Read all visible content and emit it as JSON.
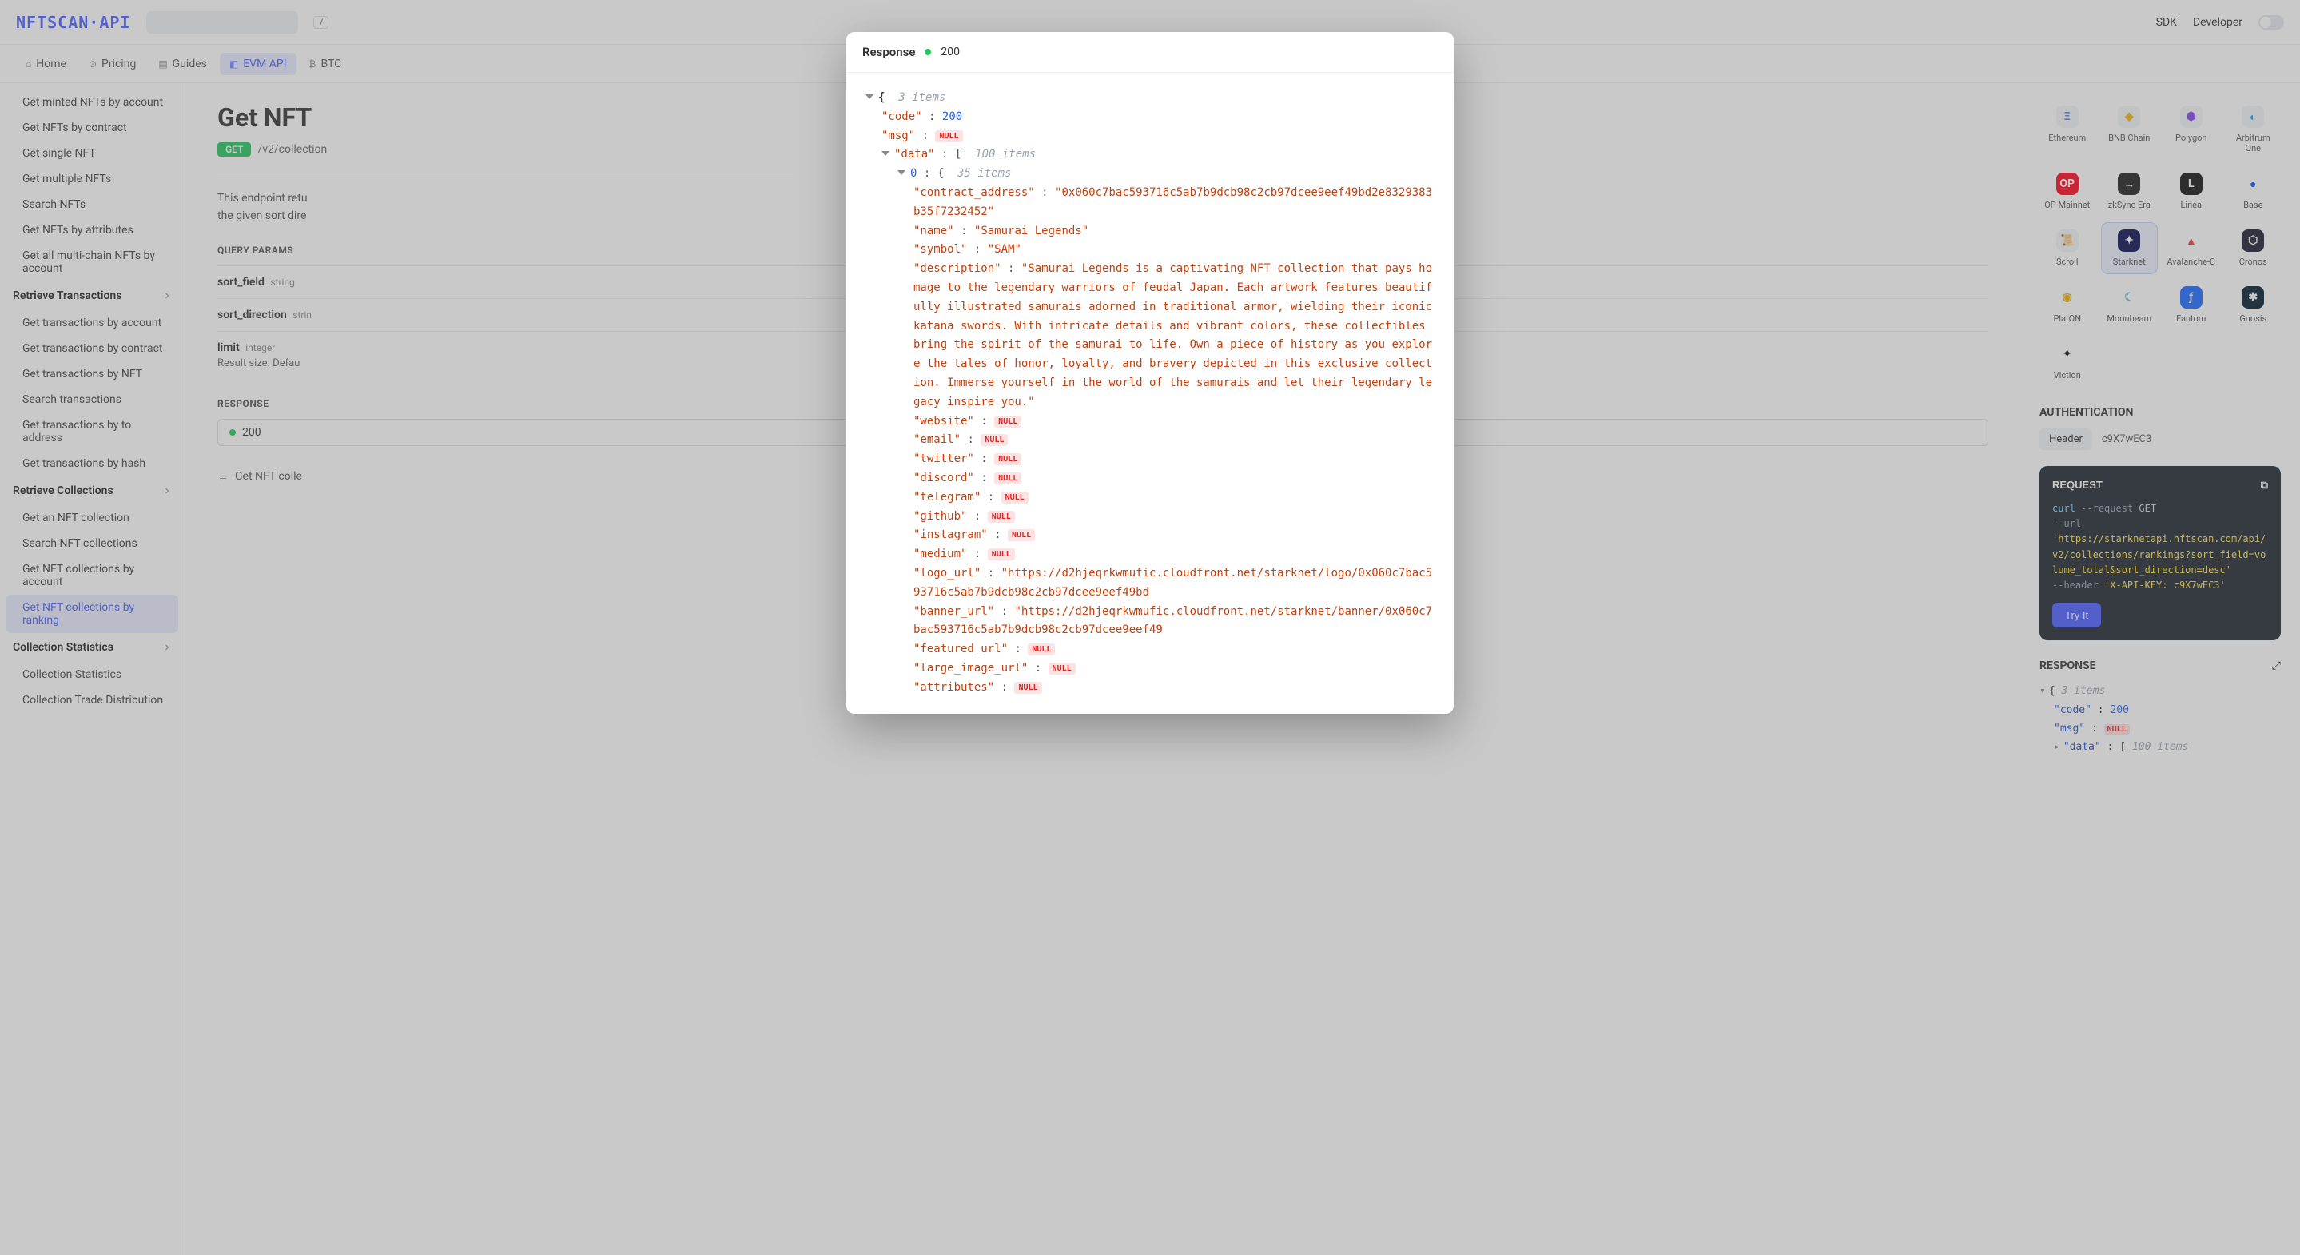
{
  "header": {
    "logo_text": "NFTSCAN·API",
    "search_placeholder": "",
    "search_shortcut": "/",
    "links": {
      "sdk": "SDK",
      "developer": "Developer"
    }
  },
  "nav_tabs": [
    {
      "label": "Home",
      "active": false
    },
    {
      "label": "Pricing",
      "active": false
    },
    {
      "label": "Guides",
      "active": false
    },
    {
      "label": "EVM API",
      "active": true
    },
    {
      "label": "BTC",
      "active": false
    }
  ],
  "sidebar": {
    "items_top": [
      "Get minted NFTs by account",
      "Get NFTs by contract",
      "Get single NFT",
      "Get multiple NFTs",
      "Search NFTs",
      "Get NFTs by attributes",
      "Get all multi-chain NFTs by account"
    ],
    "groups": [
      {
        "title": "Retrieve Transactions",
        "items": [
          "Get transactions by account",
          "Get transactions by contract",
          "Get transactions by NFT",
          "Search transactions",
          "Get transactions by to address",
          "Get transactions by hash"
        ]
      },
      {
        "title": "Retrieve Collections",
        "items": [
          "Get an NFT collection",
          "Search NFT collections",
          "Get NFT collections by account",
          "Get NFT collections by ranking"
        ],
        "active_index": 3
      },
      {
        "title": "Collection Statistics",
        "items": [
          "Collection Statistics",
          "Collection Trade Distribution"
        ]
      }
    ]
  },
  "content": {
    "title": "Get NFT",
    "method": "GET",
    "path": "/v2/collection",
    "description_line1": "This endpoint retu",
    "description_line2": "the given sort dire",
    "query_params_label": "QUERY PARAMS",
    "params": [
      {
        "name": "sort_field",
        "type": "string",
        "desc": ""
      },
      {
        "name": "sort_direction",
        "type": "strin",
        "desc": ""
      },
      {
        "name": "limit",
        "type": "integer",
        "desc": "Result size. Defau"
      }
    ],
    "response_label": "RESPONSE",
    "response_code": "200",
    "back_link": "Get NFT colle"
  },
  "networks": [
    {
      "label": "Ethereum",
      "bg": "#f3f4f6",
      "color": "#627eea",
      "glyph": "Ξ"
    },
    {
      "label": "BNB Chain",
      "bg": "#f3f4f6",
      "color": "#f0b90b",
      "glyph": "◆"
    },
    {
      "label": "Polygon",
      "bg": "#f3f4f6",
      "color": "#8247e5",
      "glyph": "⬢"
    },
    {
      "label": "Arbitrum One",
      "bg": "#f3f4f6",
      "color": "#28a0f0",
      "glyph": "◐"
    },
    {
      "label": "OP Mainnet",
      "bg": "#ff0420",
      "color": "#fff",
      "glyph": "OP"
    },
    {
      "label": "zkSync Era",
      "bg": "#1e1e1e",
      "color": "#fff",
      "glyph": "↔"
    },
    {
      "label": "Linea",
      "bg": "#121212",
      "color": "#fff",
      "glyph": "L"
    },
    {
      "label": "Base",
      "bg": "#fff",
      "color": "#0052ff",
      "glyph": "●"
    },
    {
      "label": "Scroll",
      "bg": "#f3f4f6",
      "color": "#b08050",
      "glyph": "📜"
    },
    {
      "label": "Starknet",
      "bg": "#0c0c4f",
      "color": "#fff",
      "glyph": "✦",
      "active": true
    },
    {
      "label": "Avalanche-C",
      "bg": "#fff",
      "color": "#e84142",
      "glyph": "▲"
    },
    {
      "label": "Cronos",
      "bg": "#1a1a2e",
      "color": "#fff",
      "glyph": "⬡"
    },
    {
      "label": "PlatON",
      "bg": "#fff",
      "color": "#f0b000",
      "glyph": "◉"
    },
    {
      "label": "Moonbeam",
      "bg": "#fff",
      "color": "#53cbc9",
      "glyph": "☾"
    },
    {
      "label": "Fantom",
      "bg": "#1969ff",
      "color": "#fff",
      "glyph": "ƒ"
    },
    {
      "label": "Gnosis",
      "bg": "#001a2b",
      "color": "#fff",
      "glyph": "✱"
    },
    {
      "label": "Viction",
      "bg": "#fff",
      "color": "#1a1a1a",
      "glyph": "✦"
    }
  ],
  "auth": {
    "label": "AUTHENTICATION",
    "pill": "Header",
    "value": "c9X7wEC3"
  },
  "request": {
    "label": "REQUEST",
    "curl": "curl",
    "flag1": "--request",
    "method": "GET",
    "flag2": "--url",
    "url": "'https://starknetapi.nftscan.com/api/v2/collections/rankings?sort_field=volume_total&sort_direction=desc'",
    "flag3": "--header",
    "header": "'X-API-KEY: c9X7wEC3'",
    "try_it": "Try It"
  },
  "rail_response": {
    "label": "RESPONSE",
    "root_items": "3 items",
    "code_key": "\"code\"",
    "code_val": "200",
    "msg_key": "\"msg\"",
    "data_key": "\"data\"",
    "data_items": "100 items"
  },
  "modal": {
    "title": "Response",
    "status": "200",
    "root_items": "3 items",
    "code": {
      "key": "\"code\"",
      "val": "200"
    },
    "msg": {
      "key": "\"msg\""
    },
    "data_key": "\"data\"",
    "data_items": "100 items",
    "item0_label": "0",
    "item0_items": "35 items",
    "fields": [
      {
        "key": "\"contract_address\"",
        "val": "\"0x060c7bac593716c5ab7b9dcb98c2cb97dcee9eef49bd2e8329383b35f7232452\""
      },
      {
        "key": "\"name\"",
        "val": "\"Samurai Legends\""
      },
      {
        "key": "\"symbol\"",
        "val": "\"SAM\""
      },
      {
        "key": "\"description\"",
        "val": "\"Samurai Legends is a captivating NFT collection that pays homage to the legendary warriors of feudal Japan. Each artwork features beautifully illustrated samurais adorned in traditional armor, wielding their iconic katana swords. With intricate details and vibrant colors, these collectibles bring the spirit of the samurai to life. Own a piece of history as you explore the tales of honor, loyalty, and bravery depicted in this exclusive collection. Immerse yourself in the world of the samurais and let their legendary legacy inspire you.\""
      },
      {
        "key": "\"website\"",
        "null": true
      },
      {
        "key": "\"email\"",
        "null": true
      },
      {
        "key": "\"twitter\"",
        "null": true
      },
      {
        "key": "\"discord\"",
        "null": true
      },
      {
        "key": "\"telegram\"",
        "null": true
      },
      {
        "key": "\"github\"",
        "null": true
      },
      {
        "key": "\"instagram\"",
        "null": true
      },
      {
        "key": "\"medium\"",
        "null": true
      },
      {
        "key": "\"logo_url\"",
        "val": "\"https://d2hjeqrkwmufic.cloudfront.net/starknet/logo/0x060c7bac593716c5ab7b9dcb98c2cb97dcee9eef49bd"
      },
      {
        "key": "\"banner_url\"",
        "val": "\"https://d2hjeqrkwmufic.cloudfront.net/starknet/banner/0x060c7bac593716c5ab7b9dcb98c2cb97dcee9eef49"
      },
      {
        "key": "\"featured_url\"",
        "null": true
      },
      {
        "key": "\"large_image_url\"",
        "null": true
      },
      {
        "key": "\"attributes\"",
        "null": true
      }
    ]
  },
  "null_label": "NULL"
}
